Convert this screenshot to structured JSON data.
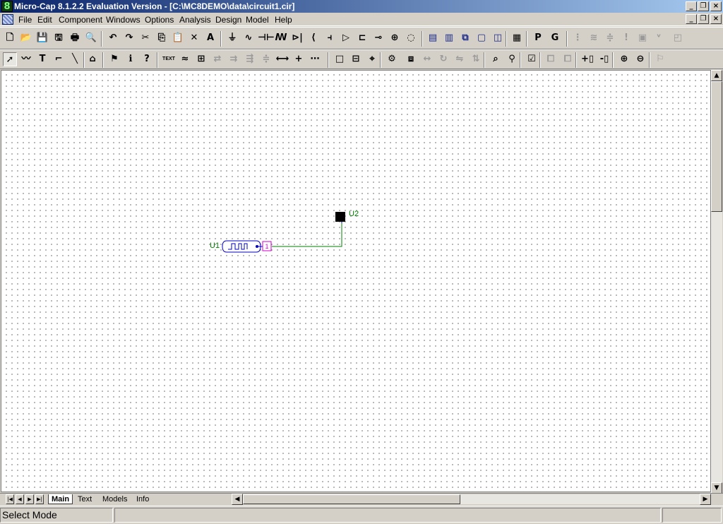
{
  "window": {
    "title": "Micro-Cap 8.1.2.2 Evaluation Version - [C:\\MC8DEMO\\data\\circuit1.cir]",
    "app_icon": "8"
  },
  "caption_buttons": {
    "minimize": "_",
    "restore": "❐",
    "close": "×"
  },
  "menu": [
    "File",
    "Edit",
    "Component",
    "Windows",
    "Options",
    "Analysis",
    "Design",
    "Model",
    "Help"
  ],
  "toolbar1": [
    {
      "name": "new-icon",
      "glyph": "🗋"
    },
    {
      "name": "open-icon",
      "glyph": "📂"
    },
    {
      "name": "save-icon",
      "glyph": "💾"
    },
    {
      "name": "save-all-icon",
      "glyph": "🖫"
    },
    {
      "name": "print-icon",
      "glyph": "🖶"
    },
    {
      "name": "print-preview-icon",
      "glyph": "🔍"
    },
    {
      "name": "undo-icon",
      "glyph": "↶"
    },
    {
      "name": "redo-icon",
      "glyph": "↷"
    },
    {
      "name": "cut-icon",
      "glyph": "✂"
    },
    {
      "name": "copy-icon",
      "glyph": "⎘"
    },
    {
      "name": "paste-icon",
      "glyph": "📋"
    },
    {
      "name": "clear-icon",
      "glyph": "✕"
    },
    {
      "name": "select-all-icon",
      "glyph": "A"
    },
    {
      "name": "ground-icon",
      "glyph": "⏚"
    },
    {
      "name": "resistor-icon",
      "glyph": "∿"
    },
    {
      "name": "capacitor-icon",
      "glyph": "⊣⊢"
    },
    {
      "name": "inductor-icon",
      "glyph": "ꟿ"
    },
    {
      "name": "diode-icon",
      "glyph": "⊳|"
    },
    {
      "name": "transistor-icon",
      "glyph": "⟨"
    },
    {
      "name": "battery-icon",
      "glyph": "⫞"
    },
    {
      "name": "opamp-icon",
      "glyph": "▷"
    },
    {
      "name": "gate-icon",
      "glyph": "⊏"
    },
    {
      "name": "switch-icon",
      "glyph": "⊸"
    },
    {
      "name": "source-icon",
      "glyph": "⊕"
    },
    {
      "name": "voltage-source-icon",
      "glyph": "◌"
    },
    {
      "name": "tile-horizontal-icon",
      "glyph": "▤"
    },
    {
      "name": "tile-vertical-icon",
      "glyph": "▥"
    },
    {
      "name": "cascade-icon",
      "glyph": "⧉"
    },
    {
      "name": "maximize-window-icon",
      "glyph": "▢"
    },
    {
      "name": "split-icon",
      "glyph": "◫"
    },
    {
      "name": "calculator-icon",
      "glyph": "▦"
    },
    {
      "name": "p-icon",
      "glyph": "P"
    },
    {
      "name": "g-icon",
      "glyph": "G"
    },
    {
      "name": "grid-dim-icon",
      "glyph": "⋮"
    },
    {
      "name": "pins-dim-icon",
      "glyph": "≋"
    },
    {
      "name": "attr-dim-icon",
      "glyph": "≑"
    },
    {
      "name": "info-dim-icon",
      "glyph": "!"
    },
    {
      "name": "part-dim-icon",
      "glyph": "▣"
    },
    {
      "name": "voltage-label-dim-icon",
      "glyph": "ᵛ"
    },
    {
      "name": "layout-dim-icon",
      "glyph": "◰"
    }
  ],
  "toolbar2": [
    {
      "name": "select-arrow-icon",
      "glyph": "➚"
    },
    {
      "name": "wire-icon",
      "glyph": "〰"
    },
    {
      "name": "text-icon",
      "glyph": "T"
    },
    {
      "name": "orthogonal-wire-icon",
      "glyph": "⌐"
    },
    {
      "name": "diagonal-wire-icon",
      "glyph": "╲"
    },
    {
      "name": "graphics-icon",
      "glyph": "⌂"
    },
    {
      "name": "flag-icon",
      "glyph": "⚑"
    },
    {
      "name": "info-icon",
      "glyph": "ℹ"
    },
    {
      "name": "help-cursor-icon",
      "glyph": "?"
    },
    {
      "name": "text-mode-icon",
      "glyph": "TEXT"
    },
    {
      "name": "attribute-icon",
      "glyph": "≈"
    },
    {
      "name": "node-numbers-icon",
      "glyph": "⊞"
    },
    {
      "name": "dim1-icon",
      "glyph": "⇄"
    },
    {
      "name": "dim2-icon",
      "glyph": "⇉"
    },
    {
      "name": "dim3-icon",
      "glyph": "⇶"
    },
    {
      "name": "dim4-icon",
      "glyph": "≑"
    },
    {
      "name": "pin-connection-icon",
      "glyph": "⟷"
    },
    {
      "name": "cross-icon",
      "glyph": "+"
    },
    {
      "name": "grid-icon",
      "glyph": "⋯"
    },
    {
      "name": "box-icon",
      "glyph": "□"
    },
    {
      "name": "frame-icon",
      "glyph": "⊟"
    },
    {
      "name": "probe-icon",
      "glyph": "⌖"
    },
    {
      "name": "properties-icon",
      "glyph": "⚙"
    },
    {
      "name": "step-icon",
      "glyph": "⧈"
    },
    {
      "name": "mirror-dim-icon",
      "glyph": "↔"
    },
    {
      "name": "rotate-dim-icon",
      "glyph": "↻"
    },
    {
      "name": "flip-dim-icon",
      "glyph": "⇋"
    },
    {
      "name": "flip-y-dim-icon",
      "glyph": "⇅"
    },
    {
      "name": "find-icon",
      "glyph": "⌕"
    },
    {
      "name": "find-next-icon",
      "glyph": "⚲"
    },
    {
      "name": "drc-icon",
      "glyph": "☑"
    },
    {
      "name": "bring-front-dim-icon",
      "glyph": "⧠"
    },
    {
      "name": "send-back-dim-icon",
      "glyph": "⧠"
    },
    {
      "name": "add-page-icon",
      "glyph": "+▯"
    },
    {
      "name": "delete-page-icon",
      "glyph": "-▯"
    },
    {
      "name": "zoom-in-icon",
      "glyph": "⊕"
    },
    {
      "name": "zoom-out-icon",
      "glyph": "⊖"
    },
    {
      "name": "flag-dim-icon",
      "glyph": "⚐"
    }
  ],
  "schematic": {
    "u1_label": "U1",
    "u2_label": "U2",
    "pin_number": "1",
    "colors": {
      "wire": "#008000",
      "component": "#0000c0",
      "label": "#008000",
      "pin_box": "#d000d0"
    }
  },
  "tabs": [
    {
      "label": "Main",
      "active": true
    },
    {
      "label": "Text",
      "active": false
    },
    {
      "label": "Models",
      "active": false
    },
    {
      "label": "Info",
      "active": false
    }
  ],
  "status": {
    "mode": "Select Mode",
    "pane2": "",
    "pane3": ""
  }
}
